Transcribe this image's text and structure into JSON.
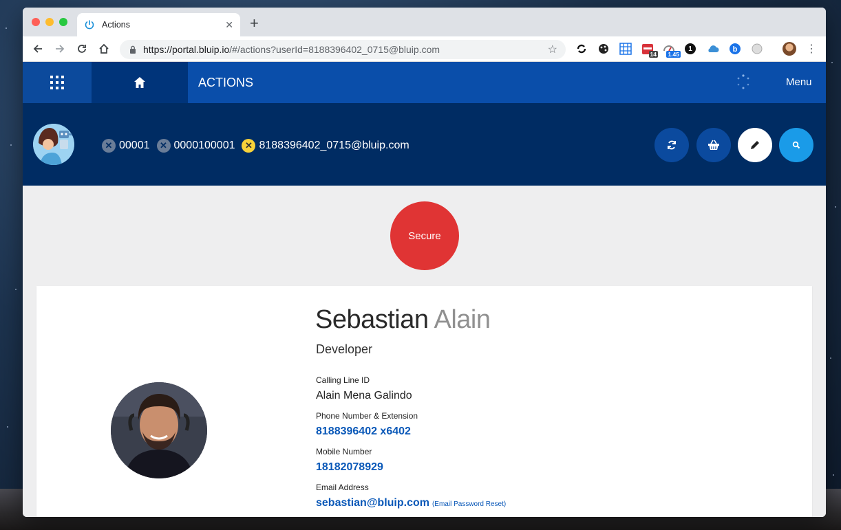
{
  "browser": {
    "tab_title": "Actions",
    "new_tab": "+",
    "url_host": "https://portal.bluip.io",
    "url_path": "/#/actions?userId=8188396402_0715@bluip.com",
    "ext_badge_1": "14",
    "ext_badge_2": "1.45",
    "ext_badge_3": "1"
  },
  "appbar": {
    "title": "ACTIONS",
    "menu_label": "Menu"
  },
  "context": {
    "chips": [
      {
        "label": "00001"
      },
      {
        "label": "0000100001"
      },
      {
        "label": "8188396402_0715@bluip.com"
      }
    ]
  },
  "status": {
    "secure_label": "Secure"
  },
  "profile": {
    "first_name": "Sebastian",
    "last_name": "Alain",
    "role": "Developer",
    "calling_line_id_label": "Calling Line ID",
    "calling_line_id": "Alain Mena Galindo",
    "phone_label": "Phone Number & Extension",
    "phone": "8188396402 x6402",
    "mobile_label": "Mobile Number",
    "mobile": "18182078929",
    "email_label": "Email Address",
    "email": "sebastian@bluip.com",
    "email_reset": "(Email Password Reset)"
  },
  "colors": {
    "appbar": "#0a4eaa",
    "ctxbar": "#002c63",
    "secure": "#e03434",
    "link": "#0a58b8"
  }
}
